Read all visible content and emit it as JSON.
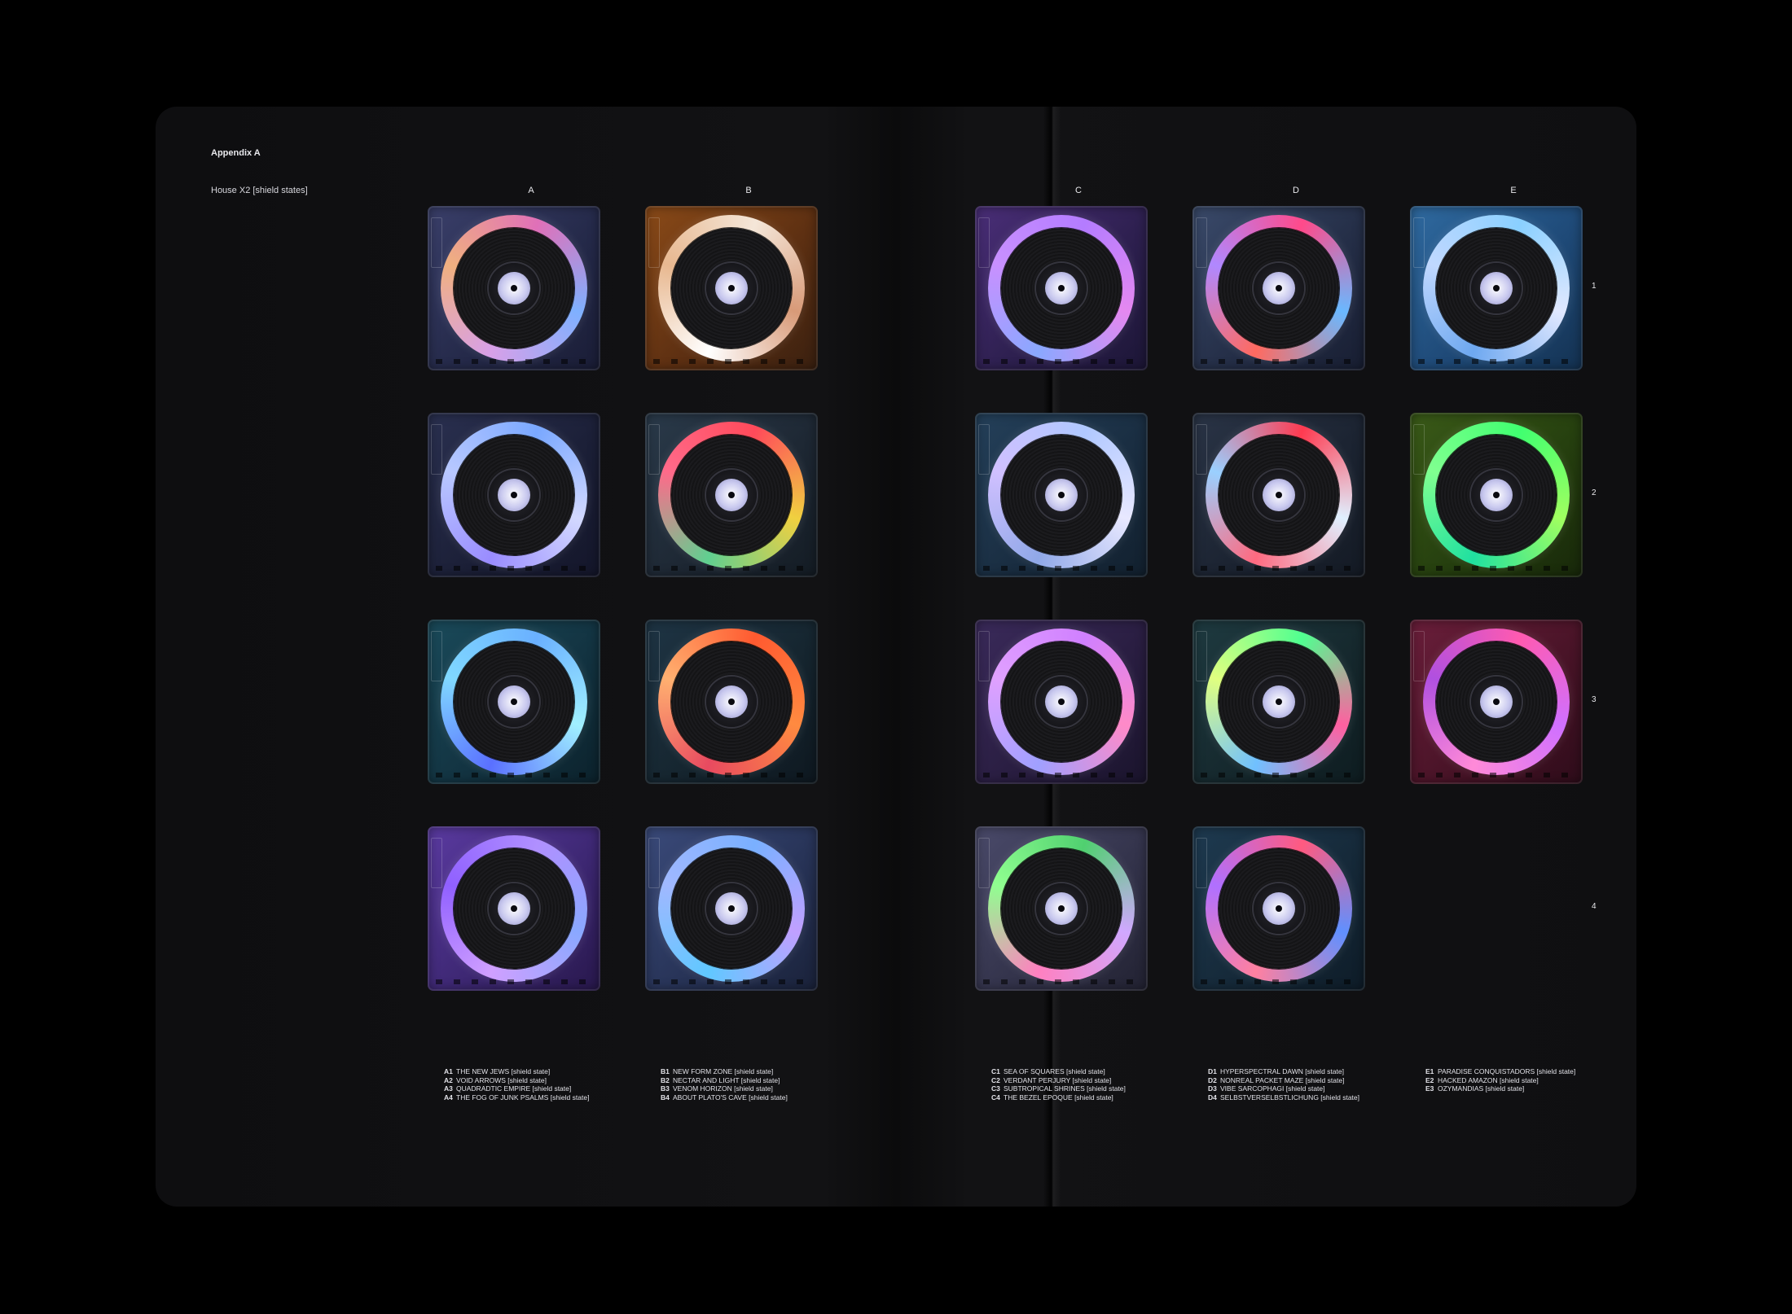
{
  "header": {
    "appendix": "Appendix A",
    "subtitle": "House X2 [shield states]"
  },
  "columns": [
    "A",
    "B",
    "C",
    "D",
    "E"
  ],
  "rows": [
    "1",
    "2",
    "3",
    "4"
  ],
  "colors": {
    "A1": {
      "body": [
        "#3a3f6a",
        "#252a4a",
        "#1a1d36"
      ],
      "ring": [
        "#e070b8",
        "#7fb0ff",
        "#d8a0e8",
        "#f0b080"
      ]
    },
    "B1": {
      "body": [
        "#8a4a18",
        "#5e3012",
        "#3a2010"
      ],
      "ring": [
        "#f4e6d8",
        "#d89a78",
        "#ffffff",
        "#e8b890"
      ]
    },
    "C1": {
      "body": [
        "#4a2e78",
        "#2e2050",
        "#1c1636"
      ],
      "ring": [
        "#b47cff",
        "#e488f0",
        "#8aa8ff",
        "#c890ff"
      ]
    },
    "D1": {
      "body": [
        "#3a4a6a",
        "#252f48",
        "#181e32"
      ],
      "ring": [
        "#ff4a8a",
        "#6ab8ff",
        "#ff6a60",
        "#b088ff"
      ]
    },
    "E1": {
      "body": [
        "#2f6aa0",
        "#1f4a78",
        "#143252"
      ],
      "ring": [
        "#8ad0ff",
        "#e0e8ff",
        "#6ea8f0",
        "#c0d8ff"
      ]
    },
    "A2": {
      "body": [
        "#2a3050",
        "#1c2038",
        "#14162a"
      ],
      "ring": [
        "#7aa8ff",
        "#d2d8ff",
        "#9a8cff",
        "#b8c8ff"
      ]
    },
    "B2": {
      "body": [
        "#2a3a4a",
        "#1e2834",
        "#141c24"
      ],
      "ring": [
        "#ff4a5a",
        "#f0d040",
        "#60d090",
        "#ff6a8a"
      ]
    },
    "C2": {
      "body": [
        "#24405a",
        "#1a2e42",
        "#12202e"
      ],
      "ring": [
        "#b0c8ff",
        "#e8e8ff",
        "#90a8e8",
        "#d0c0ff"
      ]
    },
    "D2": {
      "body": [
        "#2a3446",
        "#1c2432",
        "#141a24"
      ],
      "ring": [
        "#ff3a50",
        "#e0f0ff",
        "#ff6a80",
        "#9ad0ff"
      ]
    },
    "E2": {
      "body": [
        "#3a5a18",
        "#26400f",
        "#18280a"
      ],
      "ring": [
        "#40ff70",
        "#a0ff60",
        "#20e0a0",
        "#80ff90"
      ]
    },
    "A3": {
      "body": [
        "#1a4a5a",
        "#133442",
        "#0c222c"
      ],
      "ring": [
        "#6ab0ff",
        "#a0f0ff",
        "#5a70ff",
        "#80d8ff"
      ]
    },
    "B3": {
      "body": [
        "#1e3444",
        "#162630",
        "#0e1820"
      ],
      "ring": [
        "#ff5a30",
        "#ff8a40",
        "#e84a60",
        "#ffb070"
      ]
    },
    "C3": {
      "body": [
        "#3a2a5a",
        "#2a1e42",
        "#1a142c"
      ],
      "ring": [
        "#d080ff",
        "#ff8ac8",
        "#a0a0ff",
        "#e0a0ff"
      ]
    },
    "D3": {
      "body": [
        "#1e3a40",
        "#16292e",
        "#0e1c20"
      ],
      "ring": [
        "#50ff90",
        "#ff60a0",
        "#70c0ff",
        "#e0ff80"
      ]
    },
    "E3": {
      "body": [
        "#6a1e3a",
        "#4a1428",
        "#2e0c1a"
      ],
      "ring": [
        "#ff5ab0",
        "#d070ff",
        "#ff8ad8",
        "#b050e0"
      ]
    },
    "A4": {
      "body": [
        "#5a3aa0",
        "#3e2874",
        "#28184c"
      ],
      "ring": [
        "#b090ff",
        "#8aa8ff",
        "#d0a0ff",
        "#9060ff"
      ]
    },
    "B4": {
      "body": [
        "#3a4a7a",
        "#283458",
        "#1a223a"
      ],
      "ring": [
        "#7ab0ff",
        "#c0a0ff",
        "#60c8ff",
        "#a0b8ff"
      ]
    },
    "C4": {
      "body": [
        "#4a4a6a",
        "#34344c",
        "#222232"
      ],
      "ring": [
        "#50d070",
        "#d0a8ff",
        "#ff80c0",
        "#90ff90"
      ]
    },
    "D4": {
      "body": [
        "#1e3a50",
        "#162a3a",
        "#0e1c28"
      ],
      "ring": [
        "#ff5a80",
        "#6090ff",
        "#ff80a0",
        "#b070ff"
      ]
    }
  },
  "legend": {
    "A": [
      {
        "code": "A1",
        "text": "THE NEW JEWS [shield state]"
      },
      {
        "code": "A2",
        "text": "VOID ARROWS [shield state]"
      },
      {
        "code": "A3",
        "text": "QUADRADTIC EMPIRE [shield state]"
      },
      {
        "code": "A4",
        "text": "THE FOG OF JUNK PSALMS [shield state]"
      }
    ],
    "B": [
      {
        "code": "B1",
        "text": "NEW FORM ZONE [shield state]"
      },
      {
        "code": "B2",
        "text": "NECTAR AND LIGHT [shield state]"
      },
      {
        "code": "B3",
        "text": "VENOM HORIZON [shield state]"
      },
      {
        "code": "B4",
        "text": "ABOUT PLATO'S CAVE [shield state]"
      }
    ],
    "C": [
      {
        "code": "C1",
        "text": "SEA OF SQUARES [shield state]"
      },
      {
        "code": "C2",
        "text": "VERDANT PERJURY [shield state]"
      },
      {
        "code": "C3",
        "text": "SUBTROPICAL SHRINES [shield state]"
      },
      {
        "code": "C4",
        "text": "THE BEZEL EPOQUE [shield state]"
      }
    ],
    "D": [
      {
        "code": "D1",
        "text": "HYPERSPECTRAL DAWN [shield state]"
      },
      {
        "code": "D2",
        "text": "NONREAL PACKET MAZE [shield state]"
      },
      {
        "code": "D3",
        "text": "VIBE SARCOPHAGI [shield state]"
      },
      {
        "code": "D4",
        "text": "SELBSTVERSELBSTLICHUNG [shield state]"
      }
    ],
    "E": [
      {
        "code": "E1",
        "text": "PARADISE CONQUISTADORS [shield state]"
      },
      {
        "code": "E2",
        "text": "HACKED AMAZON [shield state]"
      },
      {
        "code": "E3",
        "text": "OZYMANDIAS [shield state]"
      }
    ]
  }
}
